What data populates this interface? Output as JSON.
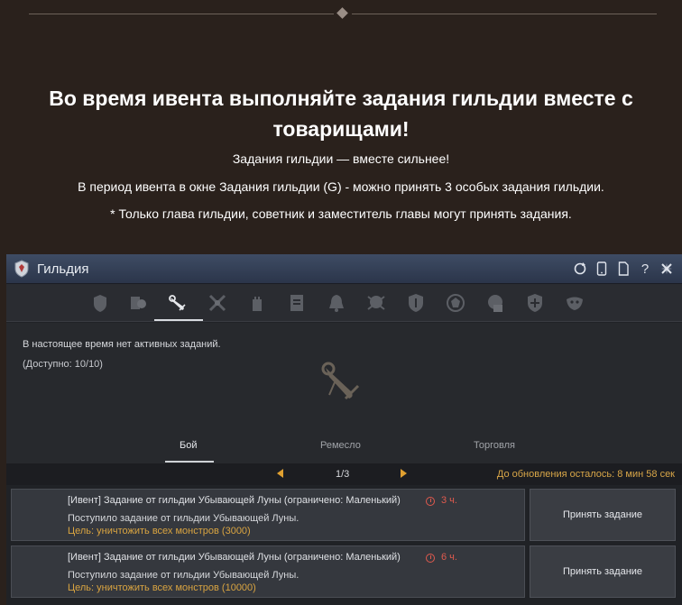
{
  "headline": "Во время ивента выполняйте задания гильдии вместе с товарищами!",
  "subtitle": "Задания гильдии — вместе сильнее!",
  "info_line": "В период ивента в окне Задания гильдии (G) - можно принять 3 особых задания гильдии.",
  "note_line": "* Только глава гильдии, советник и заместитель главы могут принять задания.",
  "window": {
    "title": "Гильдия",
    "tabs": [
      "guild-info-icon",
      "members-icon",
      "quests-scroll-icon",
      "crafting-icon",
      "fortress-icon",
      "notice-icon",
      "bell-icon",
      "skull-icon",
      "shield-icon",
      "emblem-icon",
      "seal-icon",
      "cross-shield-icon",
      "mask-icon"
    ],
    "active_tab": "quests-scroll-icon",
    "no_active_msg": "В настоящее время нет активных заданий.",
    "available_msg": "(Доступно: 10/10)",
    "subtabs": {
      "combat": "Бой",
      "craft": "Ремесло",
      "trade": "Торговля"
    },
    "pager": {
      "page": "1/3",
      "refresh": "До обновления осталось: 8 мин 58 сек"
    },
    "quests": [
      {
        "title": "[Ивент] Задание от гильдии Убывающей Луны (ограничено: Маленький)",
        "timer": "3 ч.",
        "desc": "Поступило задание от гильдии Убывающей Луны.",
        "goal": "Цель: уничтожить всех монстров (3000)",
        "accept": "Принять задание"
      },
      {
        "title": "[Ивент] Задание от гильдии Убывающей Луны (ограничено: Маленький)",
        "timer": "6 ч.",
        "desc": "Поступило задание от гильдии Убывающей Луны.",
        "goal": "Цель: уничтожить всех монстров (10000)",
        "accept": "Принять задание"
      }
    ]
  },
  "colors": {
    "page_bg": "#2a211c",
    "accent_gold": "#d9a441",
    "timer_red": "#e05a4e",
    "titlebar_blue": "#3e4c64"
  }
}
